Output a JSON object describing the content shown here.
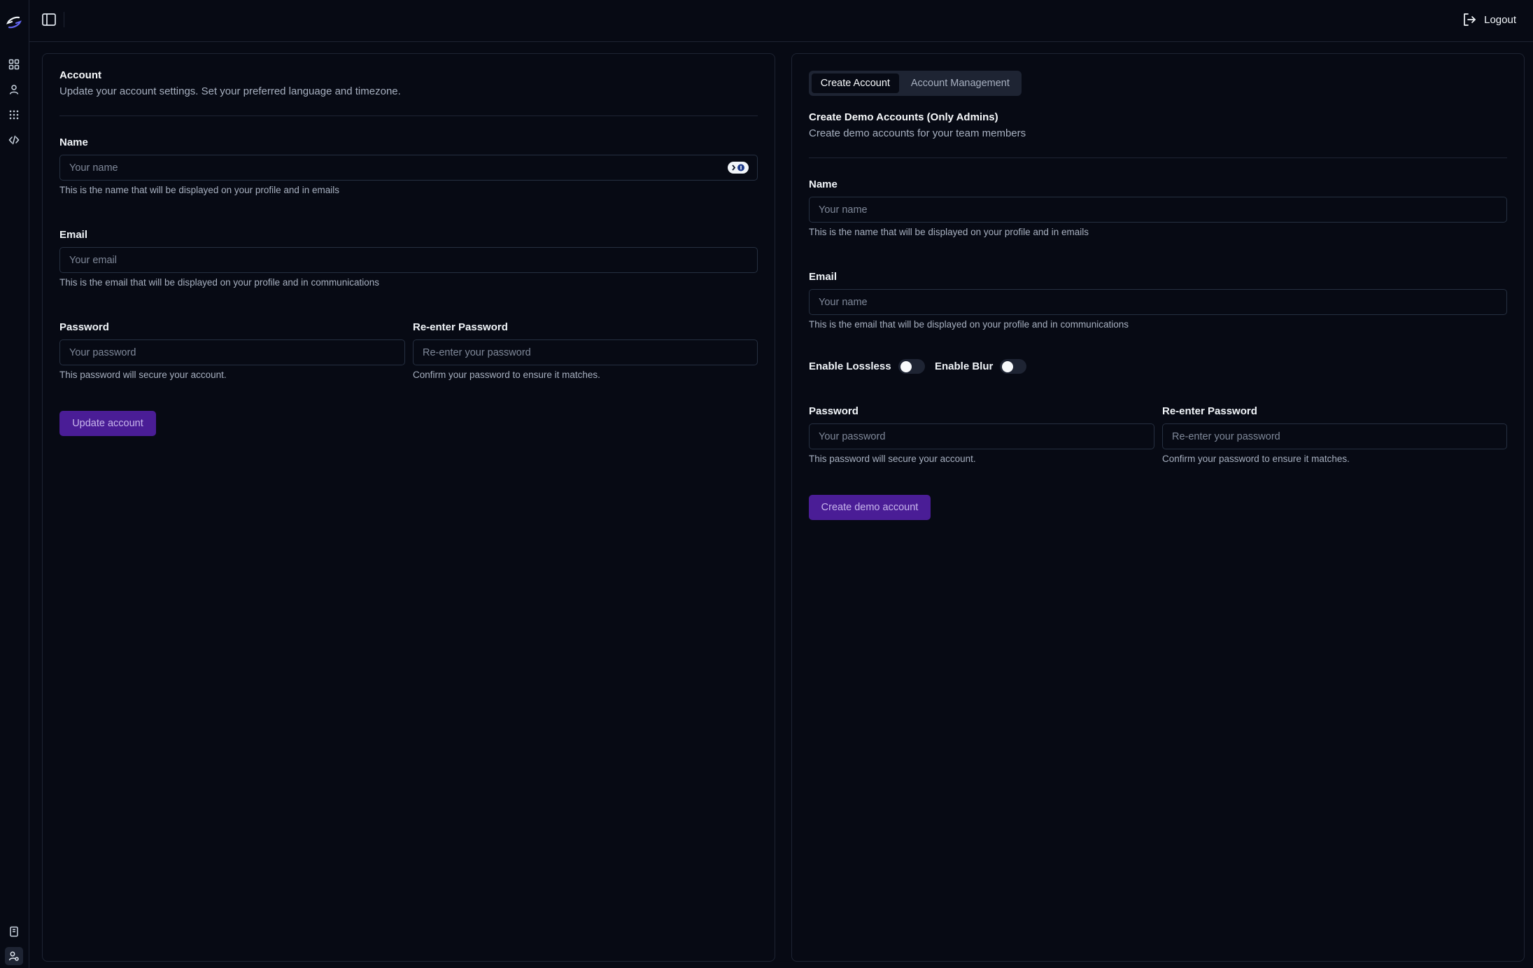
{
  "sidebar": {
    "items": [
      {
        "icon": "dashboard-icon"
      },
      {
        "icon": "user-icon"
      },
      {
        "icon": "apps-grid-icon"
      },
      {
        "icon": "code-icon"
      }
    ],
    "bottom_items": [
      {
        "icon": "notebook-icon"
      },
      {
        "icon": "user-settings-icon"
      }
    ]
  },
  "header": {
    "logout_label": "Logout"
  },
  "account": {
    "title": "Account",
    "description": "Update your account settings. Set your preferred language and timezone.",
    "name_label": "Name",
    "name_placeholder": "Your name",
    "name_hint": "This is the name that will be displayed on your profile and in emails",
    "email_label": "Email",
    "email_placeholder": "Your email",
    "email_hint": "This is the email that will be displayed on your profile and in communications",
    "password_label": "Password",
    "password_placeholder": "Your password",
    "password_hint": "This password will secure your account.",
    "reenter_label": "Re-enter Password",
    "reenter_placeholder": "Re-enter your password",
    "reenter_hint": "Confirm your password to ensure it matches.",
    "submit_label": "Update account"
  },
  "demo": {
    "tabs": [
      {
        "label": "Create Account",
        "active": true
      },
      {
        "label": "Account Management",
        "active": false
      }
    ],
    "title": "Create Demo Accounts (Only Admins)",
    "description": "Create demo accounts for your team members",
    "name_label": "Name",
    "name_placeholder": "Your name",
    "name_hint": "This is the name that will be displayed on your profile and in emails",
    "email_label": "Email",
    "email_placeholder": "Your name",
    "email_hint": "This is the email that will be displayed on your profile and in communications",
    "lossless_label": "Enable Lossless",
    "lossless_on": false,
    "blur_label": "Enable Blur",
    "blur_on": false,
    "password_label": "Password",
    "password_placeholder": "Your password",
    "password_hint": "This password will secure your account.",
    "reenter_label": "Re-enter Password",
    "reenter_placeholder": "Re-enter your password",
    "reenter_hint": "Confirm your password to ensure it matches.",
    "submit_label": "Create demo account"
  },
  "colors": {
    "background": "#070a14",
    "border": "#1e2433",
    "primary_button": "#4a1d96",
    "muted_text": "#a7b0c0"
  }
}
